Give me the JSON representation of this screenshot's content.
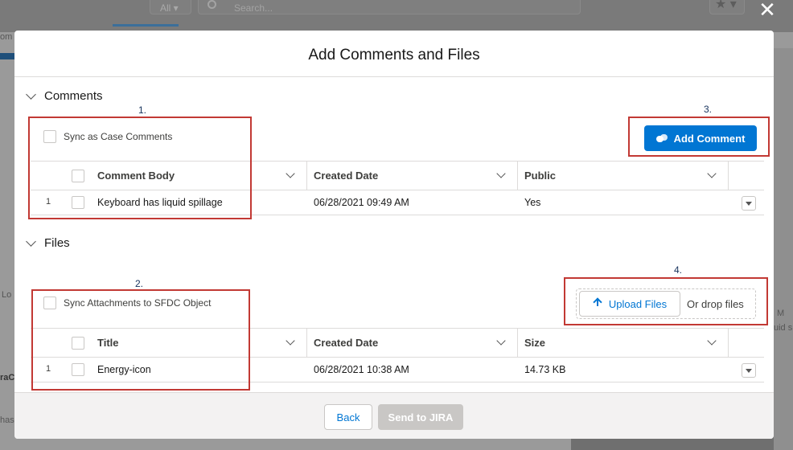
{
  "background": {
    "filter_label": "All",
    "search_placeholder": "Search...",
    "left_fragments": [
      "om",
      "Lo",
      "raC",
      "has"
    ],
    "right_fragments": [
      "M",
      "uid s"
    ]
  },
  "modal": {
    "title": "Add Comments and Files",
    "close_icon": "close-icon"
  },
  "comments": {
    "section_label": "Comments",
    "sync_label": "Sync as Case Comments",
    "add_button_label": "Add Comment",
    "columns": [
      "Comment Body",
      "Created Date",
      "Public"
    ],
    "rows": [
      {
        "num": "1",
        "body": "Keyboard has liquid spillage",
        "date": "06/28/2021 09:49 AM",
        "public": "Yes"
      }
    ]
  },
  "files": {
    "section_label": "Files",
    "sync_label": "Sync Attachments to SFDC Object",
    "upload_label": "Upload Files",
    "drop_label": "Or drop files",
    "columns": [
      "Title",
      "Created Date",
      "Size"
    ],
    "rows": [
      {
        "num": "1",
        "title": "Energy-icon",
        "date": "06/28/2021 10:38 AM",
        "size": "14.73 KB"
      }
    ]
  },
  "annotations": [
    "1.",
    "2.",
    "3.",
    "4."
  ],
  "footer": {
    "back_label": "Back",
    "send_label": "Send to JIRA"
  },
  "colors": {
    "brand_blue": "#0176d3",
    "annotation_red": "#c23934",
    "annotation_number": "#16325c"
  }
}
